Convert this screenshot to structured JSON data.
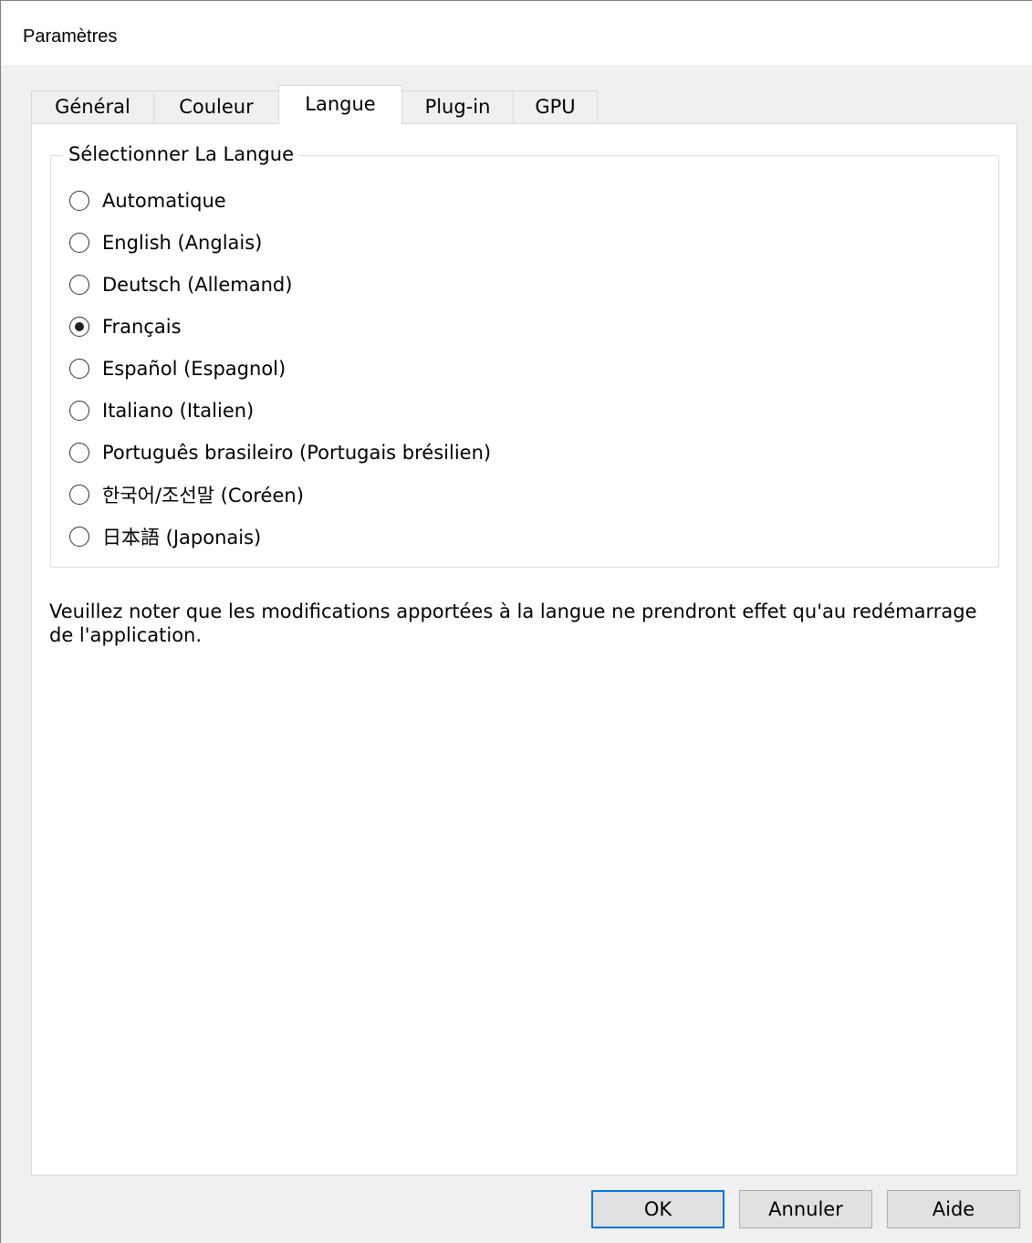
{
  "window": {
    "title": "Paramètres"
  },
  "tabs": [
    {
      "label": "Général",
      "active": false
    },
    {
      "label": "Couleur",
      "active": false
    },
    {
      "label": "Langue",
      "active": true
    },
    {
      "label": "Plug-in",
      "active": false
    },
    {
      "label": "GPU",
      "active": false
    }
  ],
  "language_group": {
    "legend": "Sélectionner La Langue",
    "selected_index": 3,
    "options": [
      {
        "label": "Automatique"
      },
      {
        "label": "English (Anglais)"
      },
      {
        "label": "Deutsch (Allemand)"
      },
      {
        "label": "Français"
      },
      {
        "label": "Español (Espagnol)"
      },
      {
        "label": "Italiano (Italien)"
      },
      {
        "label": "Português brasileiro (Portugais brésilien)"
      },
      {
        "label": "한국어/조선말 (Coréen)"
      },
      {
        "label": "日本語 (Japonais)"
      }
    ]
  },
  "note": "Veuillez noter que les modifications apportées à la langue ne prendront effet qu'au redémarrage de l'application.",
  "buttons": {
    "ok": "OK",
    "cancel": "Annuler",
    "help": "Aide"
  },
  "colors": {
    "dialog_bg": "#f0f0f0",
    "panel_bg": "#ffffff",
    "accent": "#0078d7"
  }
}
